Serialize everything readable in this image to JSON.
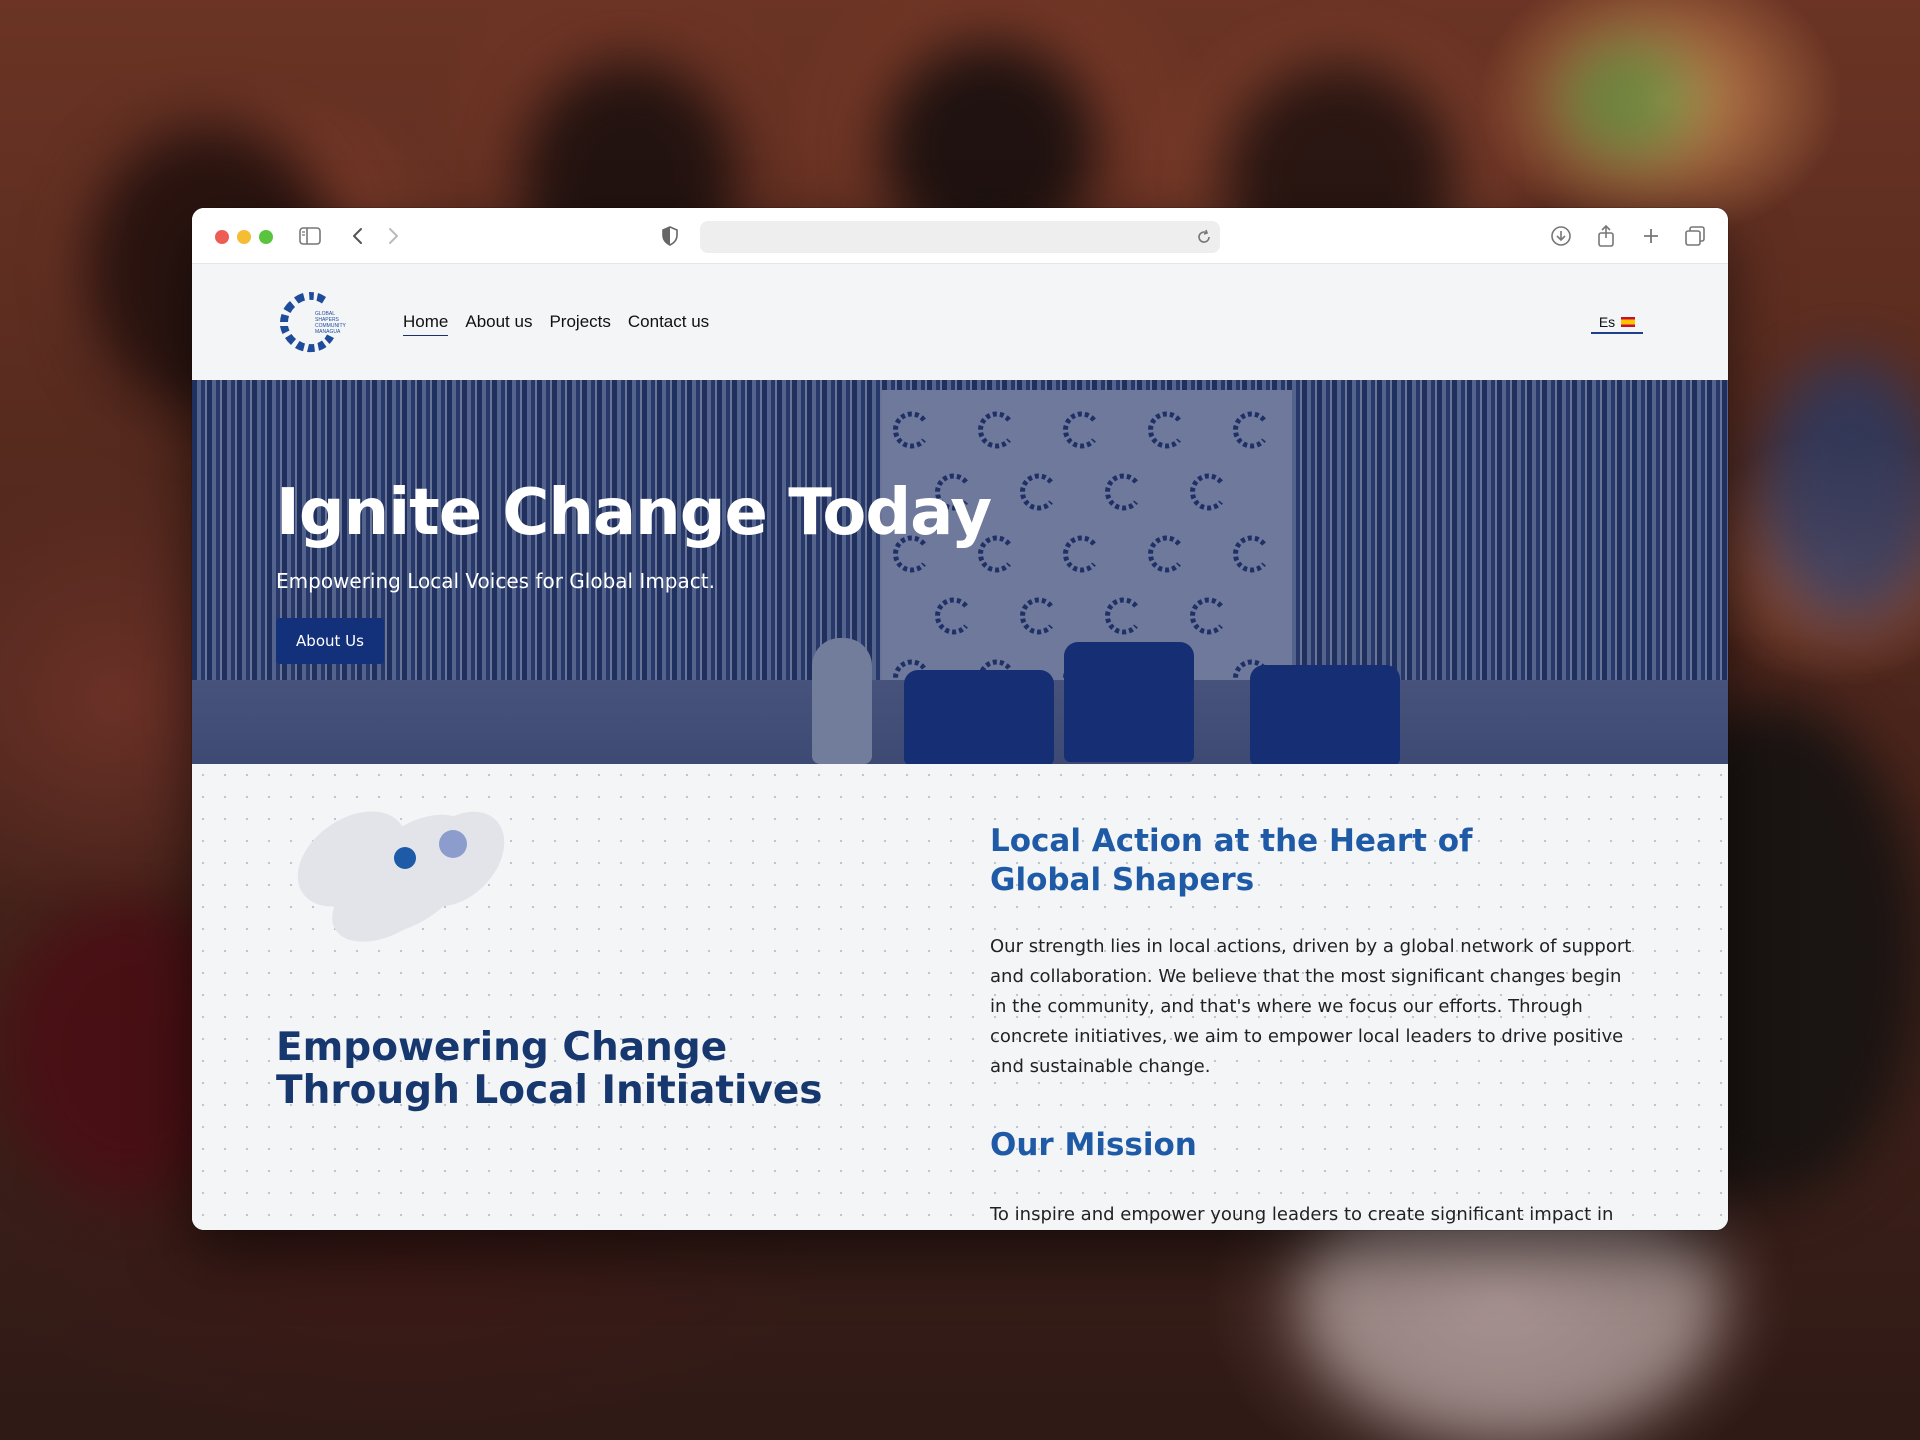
{
  "site": {
    "logo_text": [
      "GLOBAL",
      "SHAPERS",
      "COMMUNITY",
      "MANAGUA"
    ],
    "nav": [
      {
        "label": "Home",
        "active": true
      },
      {
        "label": "About us",
        "active": false
      },
      {
        "label": "Projects",
        "active": false
      },
      {
        "label": "Contact us",
        "active": false
      }
    ],
    "language": {
      "label": "Es",
      "flag": "spain-flag-icon"
    }
  },
  "hero": {
    "title": "Ignite Change Today",
    "subtitle": "Empowering Local Voices for Global Impact.",
    "button_label": "About Us"
  },
  "content": {
    "left_heading": "Empowering Change Through Local Initiatives",
    "local_heading": "Local Action at the Heart of Global Shapers",
    "local_text": "Our strength lies in local actions, driven by a global network of support and collaboration. We believe that the most significant changes begin in the community, and that's where we focus our efforts. Through concrete initiatives, we aim to empower local leaders to drive positive and sustainable change.",
    "mission_heading": "Our Mission",
    "mission_text": "To inspire and empower young leaders to create significant impact in"
  },
  "colors": {
    "brand_navy": "#13307a",
    "heading_blue": "#1f5aa6",
    "heading_navy": "#17376f"
  }
}
